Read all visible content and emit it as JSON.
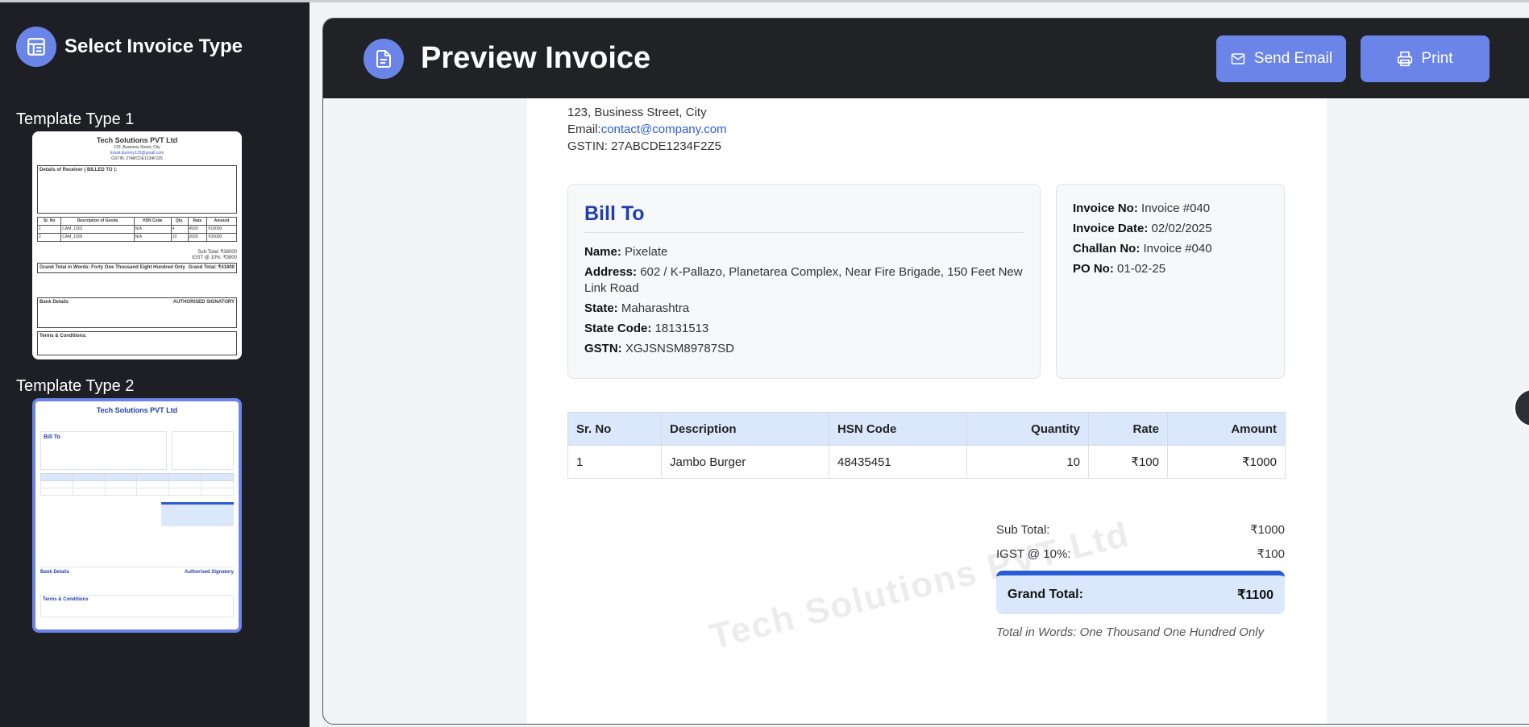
{
  "sidebar": {
    "title": "Select Invoice Type",
    "templates": [
      {
        "label": "Template Type 1"
      },
      {
        "label": "Template Type 2"
      }
    ]
  },
  "header": {
    "title": "Preview Invoice",
    "send_email_label": "Send Email",
    "print_label": "Print"
  },
  "company": {
    "address": "123, Business Street, City",
    "email_label": "Email:",
    "email": "contact@company.com",
    "gstin": "GSTIN: 27ABCDE1234F2Z5",
    "watermark": "Tech Solutions PVT Ltd"
  },
  "bill_to": {
    "title": "Bill To",
    "name_label": "Name:",
    "name": "Pixelate",
    "address_label": "Address:",
    "address": "602 / K-Pallazo, Planetarea Complex, Near Fire Brigade, 150 Feet New Link Road",
    "state_label": "State:",
    "state": "Maharashtra",
    "state_code_label": "State Code:",
    "state_code": "18131513",
    "gstn_label": "GSTN:",
    "gstn": "XGJSNSM89787SD"
  },
  "invoice_info": {
    "invoice_no_label": "Invoice No:",
    "invoice_no": "Invoice #040",
    "invoice_date_label": "Invoice Date:",
    "invoice_date": "02/02/2025",
    "challan_no_label": "Challan No:",
    "challan_no": "Invoice #040",
    "po_no_label": "PO No:",
    "po_no": "01-02-25"
  },
  "items": {
    "headers": [
      "Sr. No",
      "Description",
      "HSN Code",
      "Quantity",
      "Rate",
      "Amount"
    ],
    "rows": [
      [
        "1",
        "Jambo Burger",
        "48435451",
        "10",
        "₹100",
        "₹1000"
      ]
    ]
  },
  "totals": {
    "subtotal_label": "Sub Total:",
    "subtotal": "₹1000",
    "igst_label": "IGST @ 10%:",
    "igst": "₹100",
    "grand_label": "Grand Total:",
    "grand": "₹1100",
    "words": "Total in Words: One Thousand One Hundred Only"
  },
  "mini1": {
    "company": "Tech Solutions PVT Ltd",
    "line1": "123, Business Street, City",
    "line2": "Email:dummy123@gmail.com",
    "line3": "GSTIN: 27ABCDE1234F2Z5",
    "receiver": "Details of Receiver ( BILLED TO ):",
    "cols": [
      "Sr. No",
      "Description of Goods",
      "HSN Code",
      "Qty.",
      "Rate",
      "Amount"
    ],
    "rows": [
      [
        "1",
        "CAM_1502",
        "N/A",
        "4",
        "4500",
        "₹18000"
      ],
      [
        "2",
        "CAM_1505",
        "N/A",
        "10",
        "2000",
        "₹20000"
      ]
    ],
    "subtotal": "Sub Total: ₹38000",
    "igst": "IGST @ 10%: ₹3800",
    "grand": "Grand Total in Words: Forty One Thousand Eight Hundred Only",
    "grand_amt": "Grand Total: ₹41800",
    "bank": "Bank Details",
    "signatory": "AUTHORISED SIGNATORY",
    "terms": "Terms & Conditions:"
  },
  "mini2": {
    "company": "Tech Solutions PVT Ltd",
    "bill": "Bill To",
    "bank": "Bank Details",
    "signatory": "Authorised Signatory",
    "terms": "Terms & Conditions"
  },
  "colors": {
    "accent": "#6a84e8",
    "sidebar_bg": "#1e1f24",
    "topbar_bg": "#202226",
    "title_blue": "#1f3fae",
    "table_header": "#dbe8fb"
  }
}
